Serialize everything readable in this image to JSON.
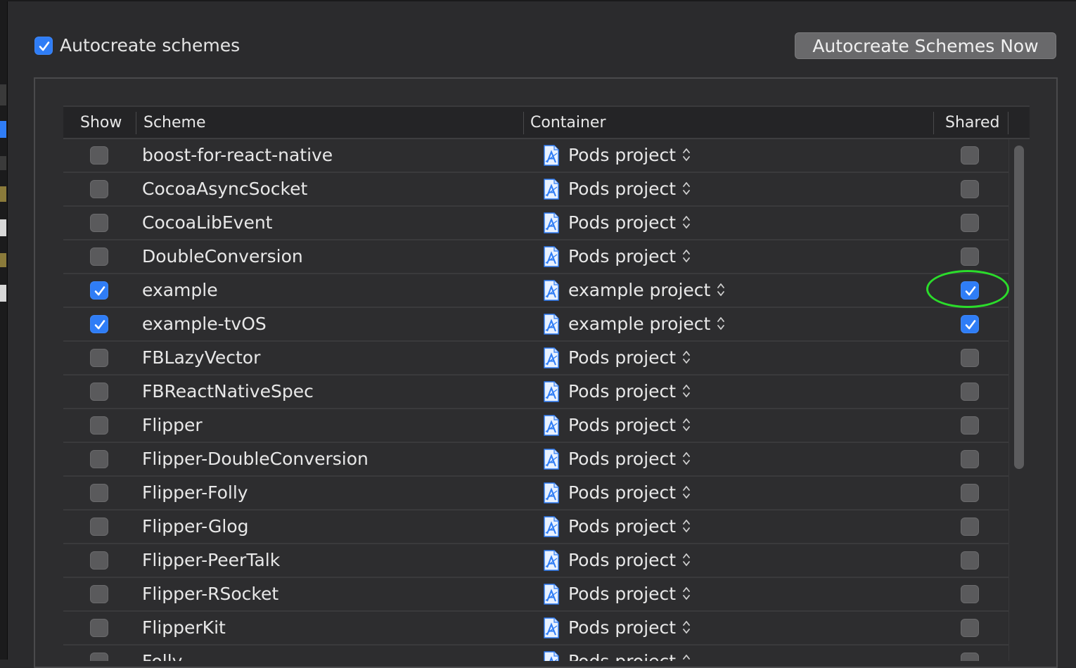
{
  "autocreate": {
    "label": "Autocreate schemes",
    "checked": true
  },
  "autocreate_now_button": "Autocreate Schemes Now",
  "columns": {
    "show": "Show",
    "scheme": "Scheme",
    "container": "Container",
    "shared": "Shared"
  },
  "rows": [
    {
      "show": false,
      "scheme": "boost-for-react-native",
      "container": "Pods project",
      "shared": false
    },
    {
      "show": false,
      "scheme": "CocoaAsyncSocket",
      "container": "Pods project",
      "shared": false
    },
    {
      "show": false,
      "scheme": "CocoaLibEvent",
      "container": "Pods project",
      "shared": false
    },
    {
      "show": false,
      "scheme": "DoubleConversion",
      "container": "Pods project",
      "shared": false
    },
    {
      "show": true,
      "scheme": "example",
      "container": "example project",
      "shared": true,
      "highlighted": true
    },
    {
      "show": true,
      "scheme": "example-tvOS",
      "container": "example project",
      "shared": true
    },
    {
      "show": false,
      "scheme": "FBLazyVector",
      "container": "Pods project",
      "shared": false
    },
    {
      "show": false,
      "scheme": "FBReactNativeSpec",
      "container": "Pods project",
      "shared": false
    },
    {
      "show": false,
      "scheme": "Flipper",
      "container": "Pods project",
      "shared": false
    },
    {
      "show": false,
      "scheme": "Flipper-DoubleConversion",
      "container": "Pods project",
      "shared": false
    },
    {
      "show": false,
      "scheme": "Flipper-Folly",
      "container": "Pods project",
      "shared": false
    },
    {
      "show": false,
      "scheme": "Flipper-Glog",
      "container": "Pods project",
      "shared": false
    },
    {
      "show": false,
      "scheme": "Flipper-PeerTalk",
      "container": "Pods project",
      "shared": false
    },
    {
      "show": false,
      "scheme": "Flipper-RSocket",
      "container": "Pods project",
      "shared": false
    },
    {
      "show": false,
      "scheme": "FlipperKit",
      "container": "Pods project",
      "shared": false
    },
    {
      "show": false,
      "scheme": "Folly",
      "container": "Pods project",
      "shared": false
    }
  ],
  "colors": {
    "checkbox_checked": "#2f7df6",
    "highlight_ring": "#2bdc2b",
    "background": "#2b2b2d"
  }
}
